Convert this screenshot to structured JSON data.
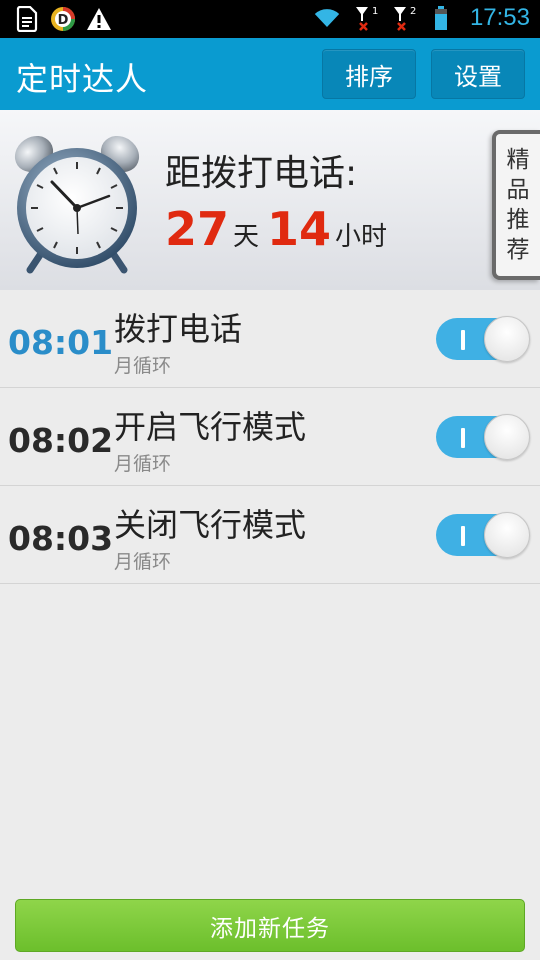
{
  "status_bar": {
    "time": "17:53",
    "sim1_label": "1",
    "sim2_label": "2",
    "icons": [
      "document-icon",
      "d-app-icon",
      "warning-icon",
      "wifi-icon",
      "signal-sim1-icon",
      "signal-sim2-icon",
      "battery-icon"
    ]
  },
  "app_bar": {
    "title": "定时达人",
    "sort_label": "排序",
    "settings_label": "设置"
  },
  "countdown": {
    "label": "距拨打电话:",
    "days": "27",
    "days_unit": "天",
    "hours": "14",
    "hours_unit": "小时",
    "promo_chars": [
      "精",
      "品",
      "推",
      "荐"
    ]
  },
  "tasks": [
    {
      "time": "08:01",
      "title": "拨打电话",
      "repeat": "月循环",
      "enabled": true,
      "highlight": true
    },
    {
      "time": "08:02",
      "title": "开启飞行模式",
      "repeat": "月循环",
      "enabled": true,
      "highlight": false
    },
    {
      "time": "08:03",
      "title": "关闭飞行模式",
      "repeat": "月循环",
      "enabled": true,
      "highlight": false
    }
  ],
  "add_button_label": "添加新任务",
  "colors": {
    "accent": "#0a9bd0",
    "countdown_number": "#e02a10",
    "active_time": "#2a8dc9",
    "toggle_on": "#3fb0e4",
    "add_button": "#7ac93a"
  }
}
